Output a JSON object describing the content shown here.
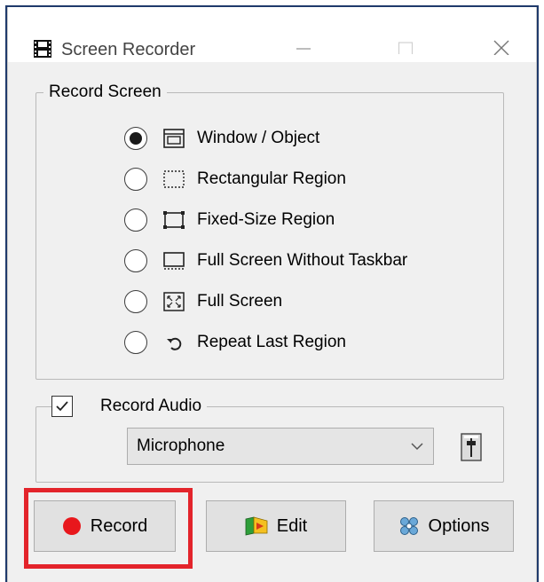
{
  "window": {
    "title": "Screen Recorder",
    "controls": [
      "minimize",
      "maximize",
      "close"
    ]
  },
  "record_screen": {
    "legend": "Record Screen",
    "selected_index": 0,
    "options": [
      {
        "label": "Window / Object",
        "icon": "window-object-icon"
      },
      {
        "label": "Rectangular Region",
        "icon": "rectangular-region-icon"
      },
      {
        "label": "Fixed-Size Region",
        "icon": "fixed-size-region-icon"
      },
      {
        "label": "Full Screen Without Taskbar",
        "icon": "fullscreen-no-taskbar-icon"
      },
      {
        "label": "Full Screen",
        "icon": "fullscreen-icon"
      },
      {
        "label": "Repeat Last Region",
        "icon": "repeat-region-icon"
      }
    ]
  },
  "record_audio": {
    "label": "Record Audio",
    "checked": true,
    "source": "Microphone"
  },
  "buttons": {
    "record": "Record",
    "edit": "Edit",
    "options": "Options"
  },
  "colors": {
    "record_dot": "#e8171c",
    "highlight": "#e3242b",
    "frame": "#1f3a6b"
  }
}
